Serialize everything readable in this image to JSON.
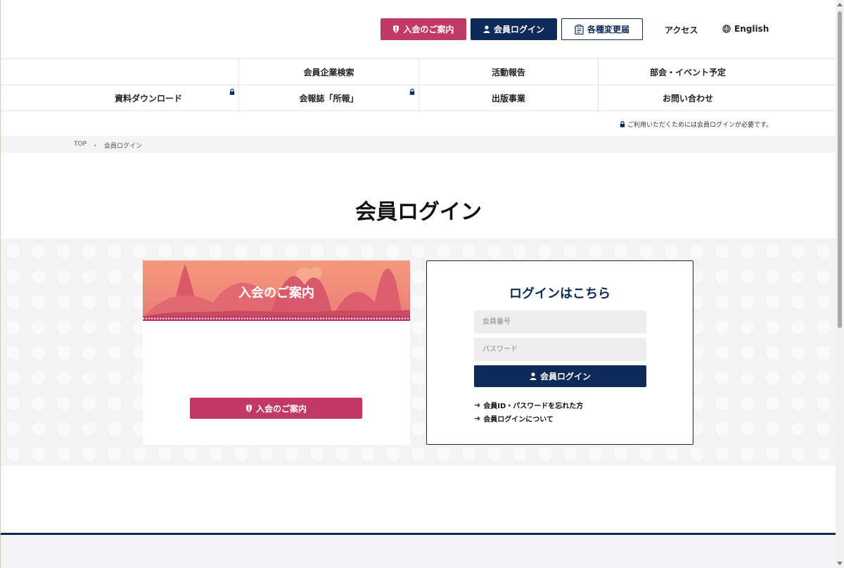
{
  "header": {
    "join_label": "入会のご案内",
    "login_label": "会員ログイン",
    "change_label": "各種変更届",
    "access_label": "アクセス",
    "english_label": "English"
  },
  "nav": {
    "row1": [
      "会員企業検索",
      "活動報告",
      "部会・イベント予定"
    ],
    "row2": [
      "資料ダウンロード",
      "会報誌「所報」",
      "出版事業",
      "お問い合わせ"
    ]
  },
  "login_note": "ご利用いただくためには会員ログインが必要です。",
  "breadcrumb": {
    "home": "TOP",
    "separator": "・",
    "current": "会員ログイン"
  },
  "page_title": "会員ログイン",
  "join_card": {
    "title": "入会のご案内",
    "button_label": "入会のご案内"
  },
  "login_card": {
    "title": "ログインはこちら",
    "member_id_placeholder": "会員番号",
    "password_placeholder": "パスワード",
    "button_label": "会員ログイン",
    "forgot_link": "会員ID・パスワードを忘れた方",
    "about_link": "会員ログインについて"
  },
  "colors": {
    "brand_navy": "#0d2a59",
    "brand_pink": "#c13a64",
    "banner_coral": "#e9736f"
  }
}
